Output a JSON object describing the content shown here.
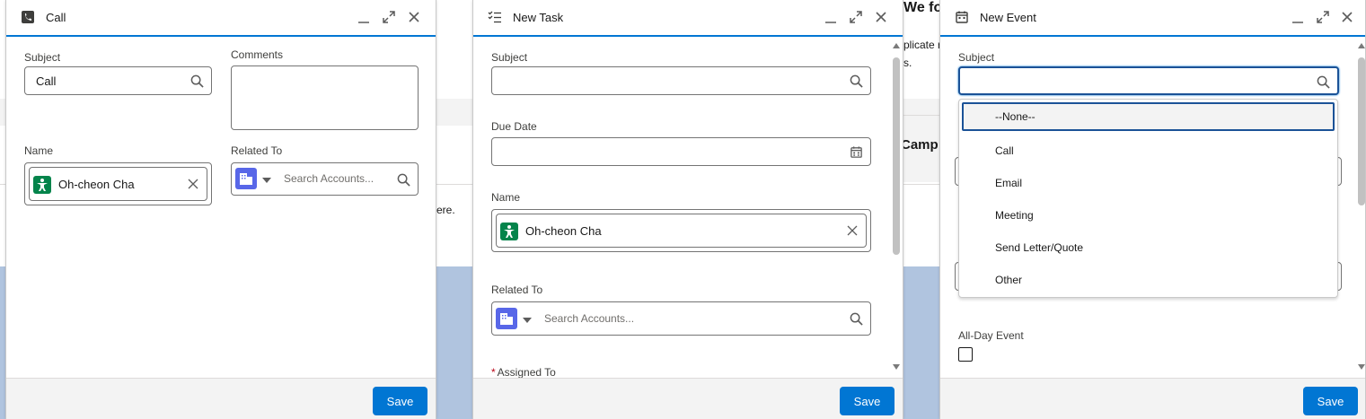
{
  "background": {
    "heading_fragment_1": "We fo",
    "text_fragment_1": "plicate r",
    "text_fragment_2": "s.",
    "heading_fragment_2": "Camp",
    "text_fragment_3": "ere."
  },
  "call_panel": {
    "title": "Call",
    "subject_label": "Subject",
    "subject_value": "Call",
    "comments_label": "Comments",
    "name_label": "Name",
    "name_value": "Oh-cheon Cha",
    "related_label": "Related To",
    "related_placeholder": "Search Accounts...",
    "save_label": "Save"
  },
  "task_panel": {
    "title": "New Task",
    "subject_label": "Subject",
    "due_date_label": "Due Date",
    "name_label": "Name",
    "name_value": "Oh-cheon Cha",
    "related_label": "Related To",
    "related_placeholder": "Search Accounts...",
    "assigned_label": "Assigned To",
    "required_mark": "*",
    "save_label": "Save"
  },
  "event_panel": {
    "title": "New Event",
    "subject_label": "Subject",
    "all_day_label": "All-Day Event",
    "save_label": "Save",
    "dropdown_options": [
      "--None--",
      "Call",
      "Email",
      "Meeting",
      "Send Letter/Quote",
      "Other"
    ],
    "selected_option": "--None--"
  },
  "colors": {
    "brand": "#0176d3",
    "contact_icon": "#04844b",
    "account_icon": "#5867e8",
    "backdrop": "#b0c4df"
  }
}
